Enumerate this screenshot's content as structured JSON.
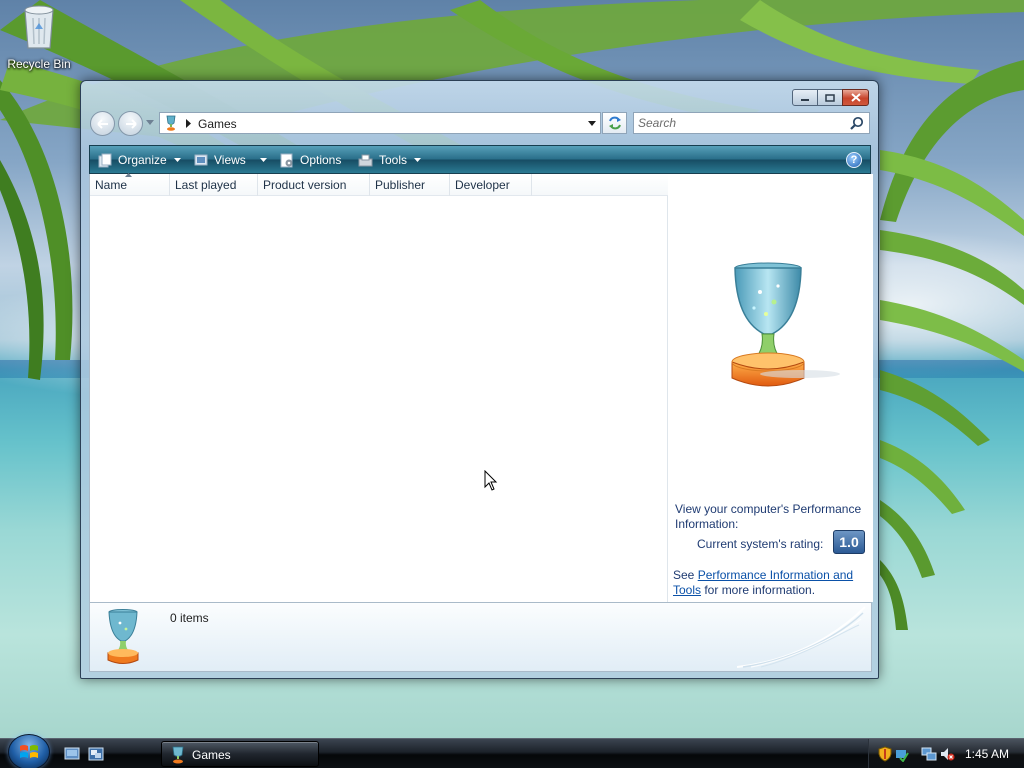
{
  "desktop": {
    "icons": [
      {
        "label": "Recycle Bin",
        "icon": "recycle-bin-icon"
      }
    ]
  },
  "window": {
    "caption_buttons": [
      "minimize",
      "maximize",
      "close"
    ],
    "address": {
      "icon": "games-trophy-icon",
      "crumb": "Games"
    },
    "search": {
      "placeholder": "Search"
    },
    "toolbar": {
      "organize_label": "Organize",
      "views_label": "Views",
      "options_label": "Options",
      "tools_label": "Tools",
      "help_label": "?"
    },
    "columns": [
      "Name",
      "Last played",
      "Product version",
      "Publisher",
      "Developer"
    ],
    "preview": {
      "perf_prompt": "View your computer's Performance Information:",
      "rating_label": "Current system's rating:",
      "rating_value": "1.0",
      "see_prefix": "See ",
      "see_link": "Performance Information and Tools",
      "see_suffix": " for more information."
    },
    "details": {
      "items_count": "0 items"
    }
  },
  "taskbar": {
    "start": "start-orb",
    "quick_launch": [
      "show-desktop-icon",
      "switch-windows-icon"
    ],
    "tasks": [
      {
        "label": "Games",
        "icon": "games-trophy-icon"
      }
    ],
    "tray_icons": [
      "security-shield-icon",
      "update-icon",
      "network-icon",
      "volume-muted-icon"
    ],
    "clock": "1:45 AM"
  },
  "colors": {
    "command_bar": "#2a6f8a",
    "link": "#0b51a8",
    "taskbar": "#1c222a",
    "rating_badge": "#2b5a95"
  }
}
